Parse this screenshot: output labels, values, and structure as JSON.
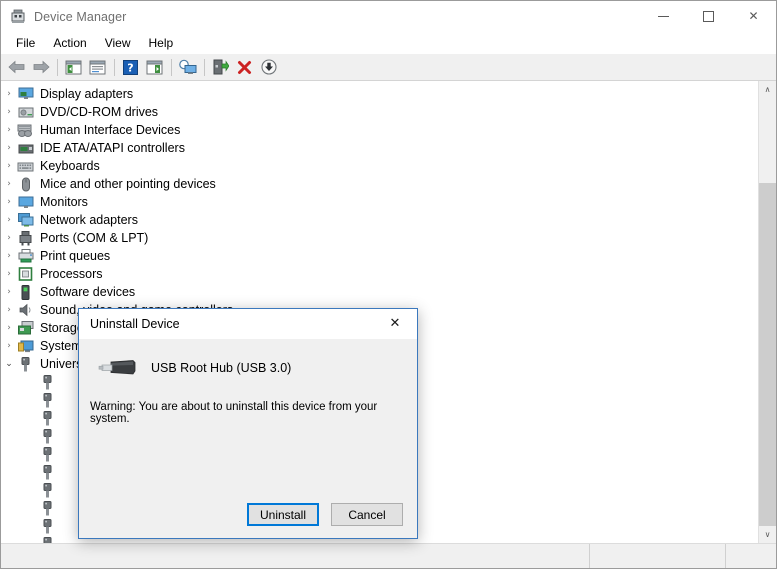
{
  "window": {
    "title": "Device Manager",
    "icon": "device-manager-icon",
    "controls": {
      "minimize": "–",
      "maximize": "□",
      "close": "✕"
    }
  },
  "menu": {
    "items": [
      {
        "label": "File",
        "name": "menu-file"
      },
      {
        "label": "Action",
        "name": "menu-action"
      },
      {
        "label": "View",
        "name": "menu-view"
      },
      {
        "label": "Help",
        "name": "menu-help"
      }
    ]
  },
  "toolbar": {
    "buttons": [
      {
        "name": "back-button",
        "icon": "arrow-left-icon"
      },
      {
        "name": "forward-button",
        "icon": "arrow-right-icon"
      },
      {
        "name": "show-hide-console-tree-button",
        "icon": "console-tree-icon"
      },
      {
        "name": "properties-button",
        "icon": "properties-icon"
      },
      {
        "name": "help-button",
        "icon": "help-question-icon"
      },
      {
        "name": "show-hide-action-pane-button",
        "icon": "action-pane-icon"
      },
      {
        "name": "scan-for-hardware-changes-button",
        "icon": "scan-monitor-icon"
      },
      {
        "name": "update-driver-button",
        "icon": "update-driver-icon"
      },
      {
        "name": "uninstall-device-button",
        "icon": "red-x-icon"
      },
      {
        "name": "disable-device-button",
        "icon": "down-arrow-circle-icon"
      }
    ]
  },
  "tree": {
    "nodes": [
      {
        "label": "Display adapters",
        "icon": "display-adapter-icon",
        "expanded": false,
        "chevron": "›"
      },
      {
        "label": "DVD/CD-ROM drives",
        "icon": "dvd-drive-icon",
        "expanded": false,
        "chevron": "›"
      },
      {
        "label": "Human Interface Devices",
        "icon": "gamepad-icon",
        "expanded": false,
        "chevron": "›"
      },
      {
        "label": "IDE ATA/ATAPI controllers",
        "icon": "ide-controller-icon",
        "expanded": false,
        "chevron": "›"
      },
      {
        "label": "Keyboards",
        "icon": "keyboard-icon",
        "expanded": false,
        "chevron": "›"
      },
      {
        "label": "Mice and other pointing devices",
        "icon": "mouse-icon",
        "expanded": false,
        "chevron": "›"
      },
      {
        "label": "Monitors",
        "icon": "monitor-icon",
        "expanded": false,
        "chevron": "›"
      },
      {
        "label": "Network adapters",
        "icon": "network-adapter-icon",
        "expanded": false,
        "chevron": "›"
      },
      {
        "label": "Ports (COM & LPT)",
        "icon": "port-icon",
        "expanded": false,
        "chevron": "›"
      },
      {
        "label": "Print queues",
        "icon": "printer-icon",
        "expanded": false,
        "chevron": "›"
      },
      {
        "label": "Processors",
        "icon": "processor-icon",
        "expanded": false,
        "chevron": "›"
      },
      {
        "label": "Software devices",
        "icon": "software-device-icon",
        "expanded": false,
        "chevron": "›"
      },
      {
        "label": "Sound, video and game controllers",
        "icon": "speaker-icon",
        "expanded": false,
        "chevron": "›"
      },
      {
        "label": "Storage controllers",
        "icon": "storage-controller-icon",
        "expanded": false,
        "chevron": "›"
      },
      {
        "label": "System devices",
        "icon": "system-device-icon",
        "expanded": false,
        "chevron": "›"
      },
      {
        "label": "Universal Serial Bus controllers",
        "icon": "usb-controller-icon",
        "expanded": true,
        "chevron": "⌄"
      }
    ],
    "usb_children_count": 10,
    "usb_child_icon": "usb-device-icon"
  },
  "scrollbar": {
    "up_arrow": "∧",
    "down_arrow": "∨"
  },
  "status_bar": {
    "message": ""
  },
  "dialog": {
    "title": "Uninstall Device",
    "close_glyph": "✕",
    "device_icon": "usb-plug-icon",
    "device_name": "USB Root Hub (USB 3.0)",
    "warning": "Warning: You are about to uninstall this device from your system.",
    "buttons": [
      {
        "label": "Uninstall",
        "name": "uninstall-confirm-button",
        "default": true
      },
      {
        "label": "Cancel",
        "name": "cancel-button",
        "default": false
      }
    ]
  },
  "colors": {
    "accent": "#0078d7",
    "dialog_border": "#3b78bd",
    "titlebar_text": "#6f6f6f",
    "toolbar_bg": "#f0f0f0",
    "scrollbar_track": "#cdcdcd",
    "red_x": "#cc2222",
    "green": "#3faa3f"
  }
}
